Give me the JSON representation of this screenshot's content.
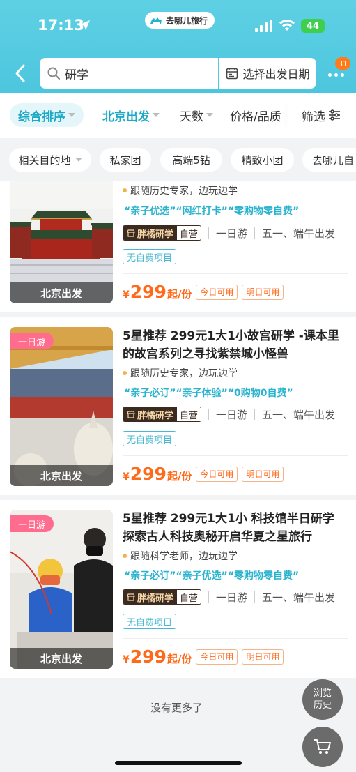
{
  "status_bar": {
    "time": "17:13",
    "app_pill": "去哪儿旅行",
    "battery": "44"
  },
  "header": {
    "search_value": "研学",
    "date_button": "选择出发日期",
    "more_badge": "31"
  },
  "sort_bar": {
    "items": [
      "综合排序",
      "北京出发",
      "天数",
      "价格/品质"
    ],
    "filter": "筛选"
  },
  "chips": [
    "相关目的地",
    "私家团",
    "高端5钻",
    "精致小团",
    "去哪儿自"
  ],
  "cards": [
    {
      "thumb_label": "北京出发",
      "title": "",
      "subtitle": "跟随历史专家，边玩边学",
      "slogan": "“亲子优选”“网红打卡”“零购物零自费”",
      "vendor": "胖橘研学",
      "vendor_self": "自营",
      "duration": "一日游",
      "period": "五一、端午出发",
      "no_self_pay": "无自费项目",
      "price": "299",
      "price_unit": "起/份",
      "avail_today": "今日可用",
      "avail_tomorrow": "明日可用"
    },
    {
      "tag": "一日游",
      "thumb_label": "北京出发",
      "title": "5星推荐 299元1大1小故宫研学 -课本里的故宫系列之寻找紫禁城小怪兽",
      "subtitle": "跟随历史专家，边玩边学",
      "slogan": "“亲子必订”“亲子体验”“0购物0自费”",
      "vendor": "胖橘研学",
      "vendor_self": "自营",
      "duration": "一日游",
      "period": "五一、端午出发",
      "no_self_pay": "无自费项目",
      "price": "299",
      "price_unit": "起/份",
      "avail_today": "今日可用",
      "avail_tomorrow": "明日可用"
    },
    {
      "tag": "一日游",
      "thumb_label": "北京出发",
      "title": "5星推荐 299元1大1小 科技馆半日研学 探索古人科技奥秘开启华夏之星旅行",
      "subtitle": "跟随科学老师，边玩边学",
      "slogan": "“亲子必订”“亲子优选”“零购物零自费”",
      "vendor": "胖橘研学",
      "vendor_self": "自营",
      "duration": "一日游",
      "period": "五一、端午出发",
      "no_self_pay": "无自费项目",
      "price": "299",
      "price_unit": "起/份",
      "avail_today": "今日可用",
      "avail_tomorrow": "明日可用"
    }
  ],
  "footer_text": "没有更多了",
  "float_history": {
    "line1": "浏览",
    "line2": "历史"
  },
  "colors": {
    "header": "#4cc6de",
    "accent": "#1ba9c6",
    "price": "#ff6a1a",
    "tag": "#ff6c8e"
  },
  "icons": [
    "location-arrow-icon",
    "camel-logo-icon",
    "signal-icon",
    "wifi-icon",
    "back-icon",
    "search-icon",
    "calendar-icon",
    "more-icon",
    "filter-icon",
    "shop-icon",
    "cart-icon"
  ]
}
